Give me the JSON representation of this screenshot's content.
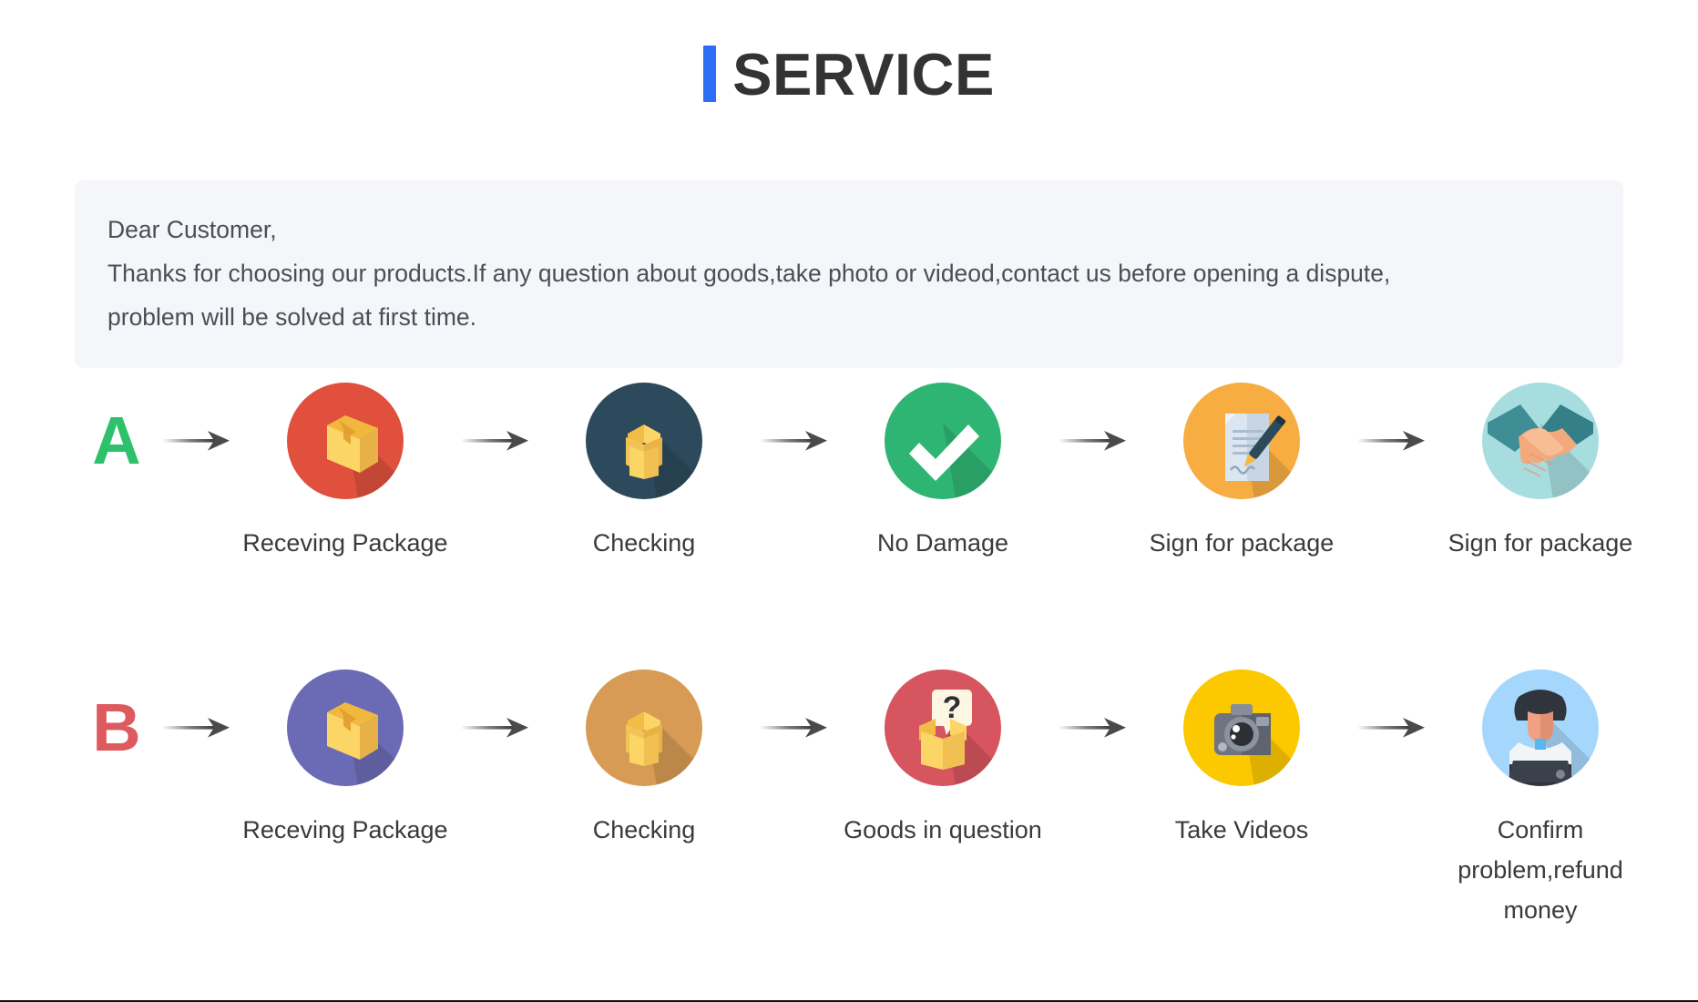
{
  "header": {
    "title": "SERVICE",
    "accent_color": "#2d6df6"
  },
  "notice": {
    "line1": "Dear Customer,",
    "line2": "Thanks for choosing our products.If any question about goods,take photo or videod,contact us before opening a dispute,",
    "line3": "problem will be solved at first time.",
    "background_color": "#f4f6fa"
  },
  "flows": [
    {
      "letter": "A",
      "letter_color": "#2ec16b",
      "steps": [
        {
          "label": "Receving Package",
          "icon": "package-box-icon",
          "circle_color": "#e0503c"
        },
        {
          "label": "Checking",
          "icon": "open-box-icon",
          "circle_color": "#2d4a5c"
        },
        {
          "label": "No Damage",
          "icon": "checkmark-icon",
          "circle_color": "#2fb573"
        },
        {
          "label": "Sign for package",
          "icon": "document-pen-icon",
          "circle_color": "#f7ad42"
        },
        {
          "label": "Sign for package",
          "icon": "handshake-icon",
          "circle_color": "#a8dde0"
        }
      ]
    },
    {
      "letter": "B",
      "letter_color": "#dd5a5f",
      "steps": [
        {
          "label": "Receving Package",
          "icon": "package-box-icon",
          "circle_color": "#6b6bb5"
        },
        {
          "label": "Checking",
          "icon": "open-box-icon",
          "circle_color": "#d79b55"
        },
        {
          "label": "Goods in question",
          "icon": "question-box-icon",
          "circle_color": "#d6555e"
        },
        {
          "label": "Take Videos",
          "icon": "camera-icon",
          "circle_color": "#fcc800"
        },
        {
          "label": "Confirm problem,refund money",
          "icon": "support-person-icon",
          "circle_color": "#a5d6fb"
        }
      ]
    }
  ],
  "icons": {
    "arrow": "arrow-right-icon"
  }
}
